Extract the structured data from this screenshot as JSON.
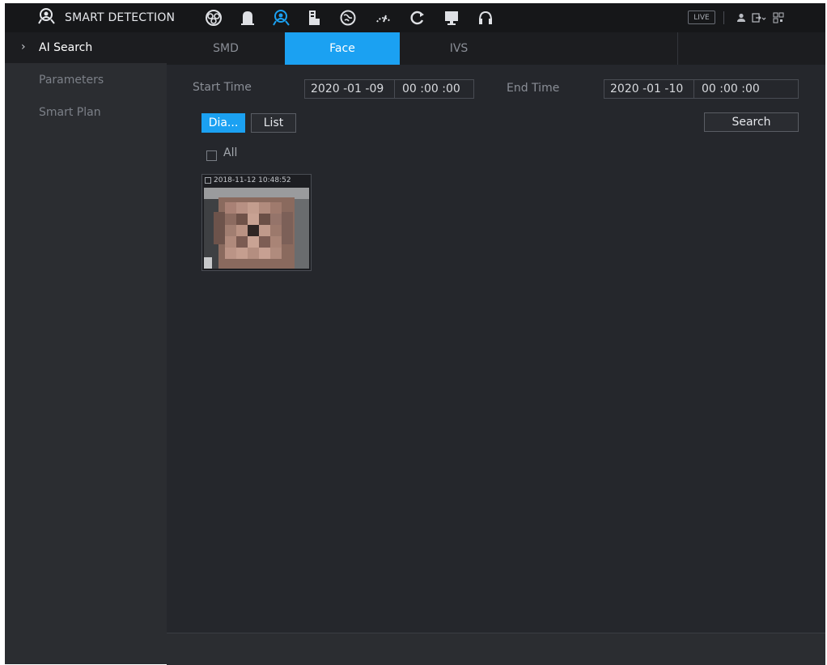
{
  "header": {
    "title": "SMART DETECTION",
    "icons": [
      "smart-detection-icon",
      "camera-icon",
      "alarm-icon",
      "ai-icon",
      "storage-icon",
      "network-icon",
      "performance-icon",
      "maintenance-icon",
      "display-icon",
      "audio-icon"
    ],
    "live_label": "LIVE"
  },
  "sidebar": {
    "items": [
      {
        "label": "AI Search",
        "active": true
      },
      {
        "label": "Parameters",
        "active": false
      },
      {
        "label": "Smart Plan",
        "active": false
      }
    ]
  },
  "tabs": [
    {
      "label": "SMD",
      "active": false
    },
    {
      "label": "Face",
      "active": true
    },
    {
      "label": "IVS",
      "active": false
    }
  ],
  "search": {
    "start_label": "Start Time",
    "start_date": "2020 -01 -09",
    "start_time": "00 :00 :00",
    "end_label": "End Time",
    "end_date": "2020 -01 -10",
    "end_time": "00 :00 :00",
    "search_button": "Search"
  },
  "view_toggle": {
    "diagram_label": "Dia...",
    "list_label": "List",
    "active": "diagram"
  },
  "select_all_label": "All",
  "results": [
    {
      "timestamp": "2018-11-12 10:48:52"
    }
  ],
  "colors": {
    "accent": "#1ba1f2",
    "background": "#25272c",
    "topbar": "#161719",
    "sidebar": "#2b2d31"
  }
}
